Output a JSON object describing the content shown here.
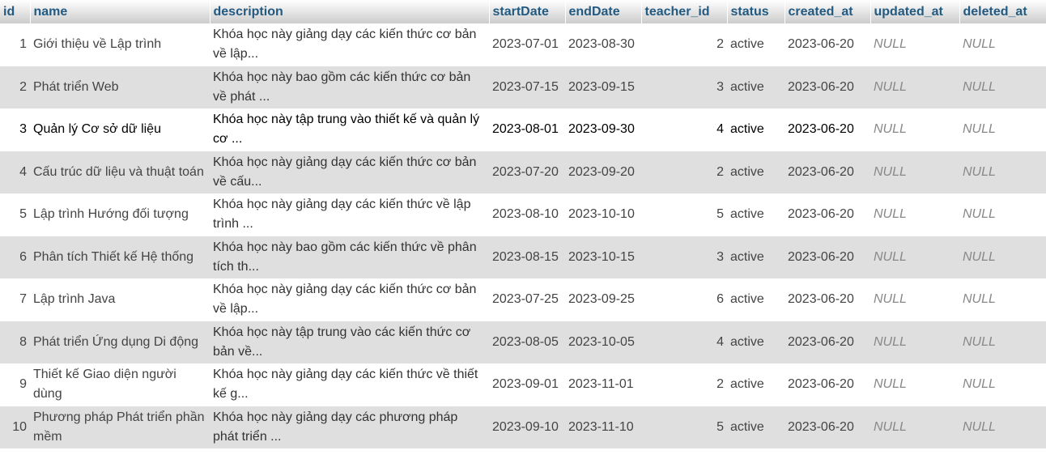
{
  "columns": [
    "id",
    "name",
    "description",
    "startDate",
    "endDate",
    "teacher_id",
    "status",
    "created_at",
    "updated_at",
    "deleted_at"
  ],
  "rows": [
    {
      "id": "1",
      "name": "Giới thiệu về Lập trình",
      "description": "Khóa học này giảng dạy các kiến thức cơ bản về lập...",
      "startDate": "2023-07-01",
      "endDate": "2023-08-30",
      "teacher_id": "2",
      "status": "active",
      "created_at": "2023-06-20",
      "updated_at": "NULL",
      "deleted_at": "NULL"
    },
    {
      "id": "2",
      "name": "Phát triển Web",
      "description": "Khóa học này bao gồm các kiến thức cơ bản về phát ...",
      "startDate": "2023-07-15",
      "endDate": "2023-09-15",
      "teacher_id": "3",
      "status": "active",
      "created_at": "2023-06-20",
      "updated_at": "NULL",
      "deleted_at": "NULL"
    },
    {
      "id": "3",
      "name": "Quản lý Cơ sở dữ liệu",
      "description": "Khóa học này tập trung vào thiết kế và quản lý cơ ...",
      "startDate": "2023-08-01",
      "endDate": "2023-09-30",
      "teacher_id": "4",
      "status": "active",
      "created_at": "2023-06-20",
      "updated_at": "NULL",
      "deleted_at": "NULL"
    },
    {
      "id": "4",
      "name": "Cấu trúc dữ liệu và thuật toán",
      "description": "Khóa học này giảng dạy các kiến thức cơ bản về cấu...",
      "startDate": "2023-07-20",
      "endDate": "2023-09-20",
      "teacher_id": "2",
      "status": "active",
      "created_at": "2023-06-20",
      "updated_at": "NULL",
      "deleted_at": "NULL"
    },
    {
      "id": "5",
      "name": "Lập trình Hướng đối tượng",
      "description": "Khóa học này giảng dạy các kiến thức về lập trình ...",
      "startDate": "2023-08-10",
      "endDate": "2023-10-10",
      "teacher_id": "5",
      "status": "active",
      "created_at": "2023-06-20",
      "updated_at": "NULL",
      "deleted_at": "NULL"
    },
    {
      "id": "6",
      "name": "Phân tích Thiết kế Hệ thống",
      "description": "Khóa học này bao gồm các kiến thức về phân tích th...",
      "startDate": "2023-08-15",
      "endDate": "2023-10-15",
      "teacher_id": "3",
      "status": "active",
      "created_at": "2023-06-20",
      "updated_at": "NULL",
      "deleted_at": "NULL"
    },
    {
      "id": "7",
      "name": "Lập trình Java",
      "description": "Khóa học này giảng dạy các kiến thức cơ bản về lập...",
      "startDate": "2023-07-25",
      "endDate": "2023-09-25",
      "teacher_id": "6",
      "status": "active",
      "created_at": "2023-06-20",
      "updated_at": "NULL",
      "deleted_at": "NULL"
    },
    {
      "id": "8",
      "name": "Phát triển Ứng dụng Di động",
      "description": "Khóa học này tập trung vào các kiến thức cơ bản về...",
      "startDate": "2023-08-05",
      "endDate": "2023-10-05",
      "teacher_id": "4",
      "status": "active",
      "created_at": "2023-06-20",
      "updated_at": "NULL",
      "deleted_at": "NULL"
    },
    {
      "id": "9",
      "name": "Thiết kế Giao diện người dùng",
      "description": "Khóa học này giảng dạy các kiến thức về thiết kế g...",
      "startDate": "2023-09-01",
      "endDate": "2023-11-01",
      "teacher_id": "2",
      "status": "active",
      "created_at": "2023-06-20",
      "updated_at": "NULL",
      "deleted_at": "NULL"
    },
    {
      "id": "10",
      "name": "Phương pháp Phát triển phần mềm",
      "description": "Khóa học này giảng dạy các phương pháp phát triển ...",
      "startDate": "2023-09-10",
      "endDate": "2023-11-10",
      "teacher_id": "5",
      "status": "active",
      "created_at": "2023-06-20",
      "updated_at": "NULL",
      "deleted_at": "NULL"
    }
  ]
}
